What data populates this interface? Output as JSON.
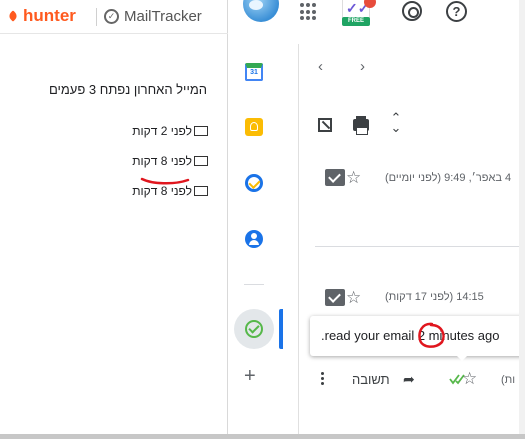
{
  "mailtracker": {
    "brand_hunter": "hunter",
    "brand_mailtracker": "MailTracker",
    "title": "המייל האחרון נפתח 3 פעמים",
    "opens": [
      "לפני 2 דקות",
      "לפני 8 דקות",
      "לפני 8 דקות"
    ]
  },
  "topbar": {
    "free_label": "FREE",
    "help_symbol": "?"
  },
  "rail": {
    "calendar_label": "31",
    "add_symbol": "+"
  },
  "mail": {
    "nav_prev": "‹",
    "nav_next": "›",
    "expand_symbol": "⌃⌄",
    "message_1_date": "4 באפר׳, 9:49 (לפני יומיים)",
    "message_2_date": "14:15 (לפני 17 דקות)",
    "star_symbol": "☆",
    "tooltip_text": ".read your email 2 minutes ago",
    "reply_label": "תשובה",
    "reply_arrow": "➦",
    "partial_paren": "(ות"
  },
  "colors": {
    "hunter_orange": "#ff5a1f",
    "annotation_red": "#e0161e",
    "mailtracker_green": "#56b84a",
    "active_blue": "#1a73e8"
  }
}
